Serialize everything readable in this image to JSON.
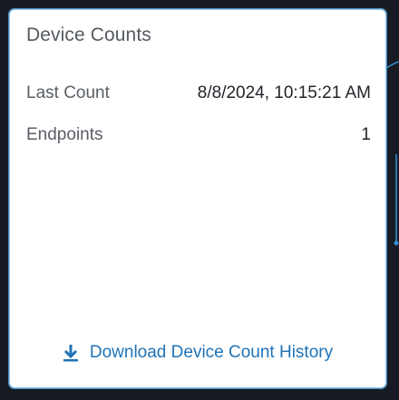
{
  "card": {
    "title": "Device Counts",
    "rows": [
      {
        "label": "Last Count",
        "value": "8/8/2024, 10:15:21 AM"
      },
      {
        "label": "Endpoints",
        "value": "1"
      }
    ],
    "download_link": {
      "label": "Download Device Count History",
      "icon": "download-icon"
    }
  },
  "colors": {
    "link": "#1f73b7",
    "card_border": "#8fc4ea",
    "background": "#171c24"
  }
}
